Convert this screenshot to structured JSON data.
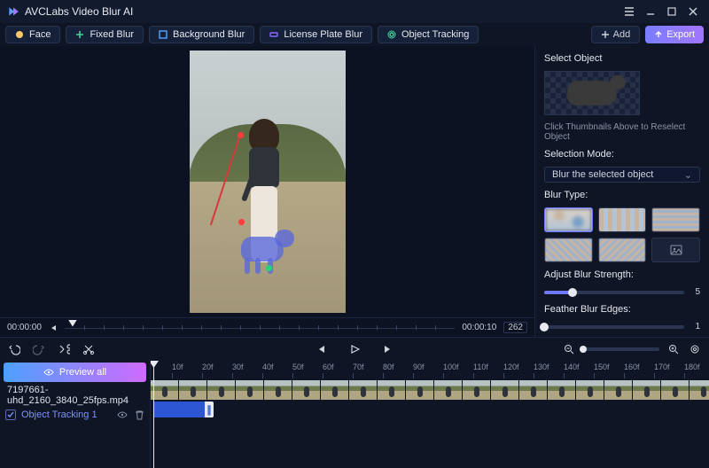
{
  "app": {
    "title": "AVCLabs Video Blur AI"
  },
  "toolbar": {
    "chips": [
      {
        "label": "Face",
        "dot": "#ffc56b"
      },
      {
        "label": "Fixed Blur",
        "dot": "#43d39e"
      },
      {
        "label": "Background Blur",
        "dot": "#5aa0ff"
      },
      {
        "label": "License Plate Blur",
        "dot": "#8a6bff"
      },
      {
        "label": "Object Tracking",
        "dot": "#43d39e"
      }
    ],
    "add_label": "Add",
    "export_label": "Export"
  },
  "preview": {
    "time_start": "00:00:00",
    "time_end": "00:00:10",
    "frame_count": "262"
  },
  "side": {
    "select_object_title": "Select Object",
    "reselect_hint": "Click Thumbnails Above to Reselect Object",
    "selection_mode_label": "Selection Mode:",
    "selection_mode_value": "Blur the selected object",
    "blur_type_label": "Blur Type:",
    "blur_types": [
      "gaussian",
      "pixel",
      "streak-h",
      "streak-d1",
      "streak-d2",
      "custom-image"
    ],
    "blur_type_selected": 0,
    "strength_label": "Adjust Blur Strength:",
    "strength_value": "5",
    "strength_pct": 20,
    "feather_label": "Feather Blur Edges:",
    "feather_value": "1",
    "feather_pct": 0
  },
  "timeline": {
    "preview_all_label": "Preview all",
    "file_name": "7197661-uhd_2160_3840_25fps.mp4",
    "track_name": "Object Tracking 1",
    "ruler_ticks": [
      "10f",
      "20f",
      "30f",
      "40f",
      "50f",
      "60f",
      "70f",
      "80f",
      "90f",
      "100f",
      "110f",
      "120f",
      "130f",
      "140f",
      "150f",
      "160f",
      "170f",
      "180f"
    ]
  }
}
